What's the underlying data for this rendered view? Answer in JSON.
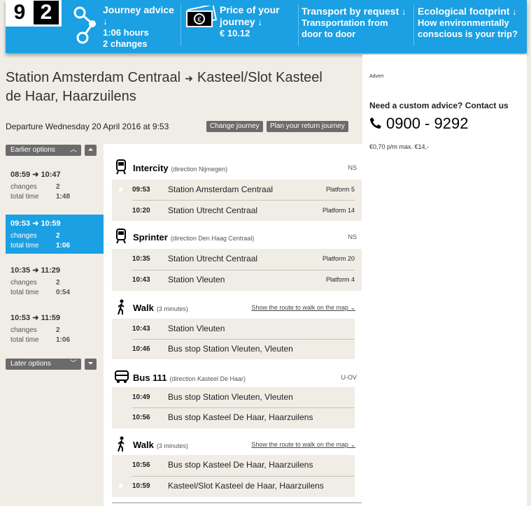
{
  "logo": {
    "digit1": "9",
    "digit2": "2"
  },
  "topbar": {
    "advice": {
      "title": "Journey advice",
      "arrow": "↓",
      "duration": "1:06 hours",
      "changes": "2 changes"
    },
    "price": {
      "title": "Price of your",
      "title2": "journey",
      "arrow": "↓",
      "value": "€ 10.12"
    },
    "transport": {
      "title": "Transport by request",
      "arrow": "↓",
      "line1": "Transportation from",
      "line2": "door to door"
    },
    "eco": {
      "title": "Ecological footprint",
      "arrow": "↓",
      "line1": "How environmentally",
      "line2": "conscious is your trip?"
    }
  },
  "route": {
    "from": "Station Amsterdam Centraal",
    "arrow": "➜",
    "to_line1": "Kasteel/Slot Kasteel",
    "to_line2": "de Haar, Haarzuilens"
  },
  "departure": "Departure Wednesday 20 April 2016 at 9:53",
  "buttons": {
    "change": "Change journey",
    "return": "Plan your return journey"
  },
  "sidebar": {
    "earlier": "Earlier options",
    "later": "Later options",
    "options": [
      {
        "times": "08:59 ➜ 10:47",
        "changes_label": "changes",
        "changes": "2",
        "total_label": "total time",
        "total": "1:48"
      },
      {
        "times": "09:53 ➜ 10:59",
        "changes_label": "changes",
        "changes": "2",
        "total_label": "total time",
        "total": "1:06"
      },
      {
        "times": "10:35 ➜ 11:29",
        "changes_label": "changes",
        "changes": "2",
        "total_label": "total time",
        "total": "0:54"
      },
      {
        "times": "10:53 ➜ 11:59",
        "changes_label": "changes",
        "changes": "2",
        "total_label": "total time",
        "total": "1:06"
      }
    ]
  },
  "legs": [
    {
      "mode": "Intercity",
      "direction": "(direction Nijmegen)",
      "operator": "NS",
      "stops": [
        {
          "time": "09:53",
          "name": "Station Amsterdam Centraal",
          "platform": "Platform 5"
        },
        {
          "time": "10:20",
          "name": "Station Utrecht Centraal",
          "platform": "Platform 14"
        }
      ]
    },
    {
      "mode": "Sprinter",
      "direction": "(direction Den Haag Centraal)",
      "operator": "NS",
      "stops": [
        {
          "time": "10:35",
          "name": "Station Utrecht Centraal",
          "platform": "Platform 20"
        },
        {
          "time": "10:43",
          "name": "Station Vleuten",
          "platform": "Platform 4"
        }
      ]
    },
    {
      "mode": "Walk",
      "direction": "(3 minutes)",
      "link": "Show the route to walk on the map ⌄",
      "stops": [
        {
          "time": "10:43",
          "name": "Station Vleuten"
        },
        {
          "time": "10:46",
          "name": "Bus stop Station Vleuten, Vleuten"
        }
      ]
    },
    {
      "mode": "Bus 111",
      "direction": "(direction Kasteel De Haar)",
      "operator": "U-OV",
      "stops": [
        {
          "time": "10:49",
          "name": "Bus stop Station Vleuten, Vleuten"
        },
        {
          "time": "10:56",
          "name": "Bus stop Kasteel De Haar, Haarzuilens"
        }
      ]
    },
    {
      "mode": "Walk",
      "direction": "(3 minutes)",
      "link": "Show the route to walk on the map ⌄",
      "stops": [
        {
          "time": "10:56",
          "name": "Bus stop Kasteel De Haar, Haarzuilens"
        },
        {
          "time": "10:59",
          "name": "Kasteel/Slot Kasteel de Haar, Haarzuilens"
        }
      ]
    }
  ],
  "right": {
    "advert": "Advert",
    "custom": "Need a custom advice? Contact us",
    "phone": "0900 - 9292",
    "fee": "€0,70 p/m max. €14,-"
  }
}
